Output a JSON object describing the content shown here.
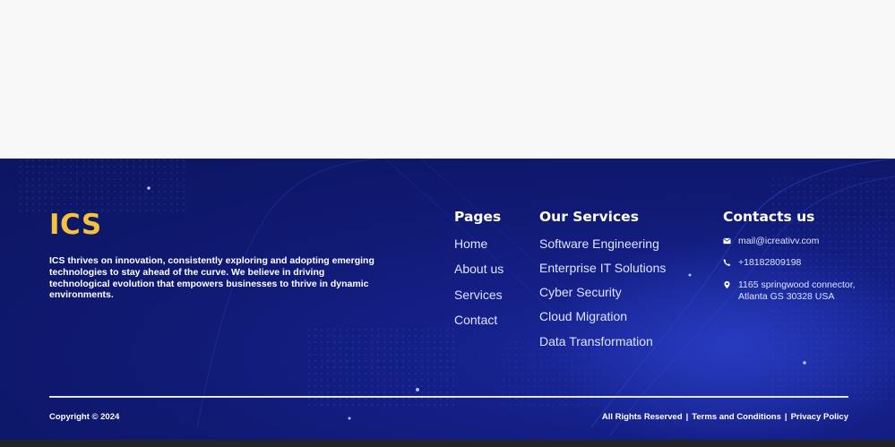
{
  "brand": {
    "name": "ICS",
    "color": "#f5c33b"
  },
  "about": {
    "text": "ICS thrives on innovation, consistently exploring and adopting emerging technologies to stay ahead of the curve. We believe in driving technological evolution that empowers businesses to thrive in dynamic environments."
  },
  "pages": {
    "title": "Pages",
    "links": [
      "Home",
      "About us",
      "Services",
      "Contact"
    ]
  },
  "services": {
    "title": "Our Services",
    "links": [
      "Software Engineering",
      "Enterprise IT Solutions",
      "Cyber Security",
      "Cloud Migration",
      "Data Transformation"
    ]
  },
  "contacts": {
    "title": "Contacts us",
    "email": {
      "icon": "envelope-icon",
      "value": "mail@icreativv.com"
    },
    "phone": {
      "icon": "phone-icon",
      "value": "+18182809198"
    },
    "address": {
      "icon": "location-pin-icon",
      "line1": "1165 springwood connector,",
      "line2": "Atlanta GS 30328 USA"
    }
  },
  "bottom": {
    "copyright": "Copyright © 2024",
    "rights": "All Rights Reserved",
    "terms": "Terms and Conditions",
    "privacy": "Privacy Policy",
    "separator": "|"
  },
  "colors": {
    "footer_bg": "#0f1970",
    "accent": "#f5c33b",
    "text": "#ffffff"
  }
}
